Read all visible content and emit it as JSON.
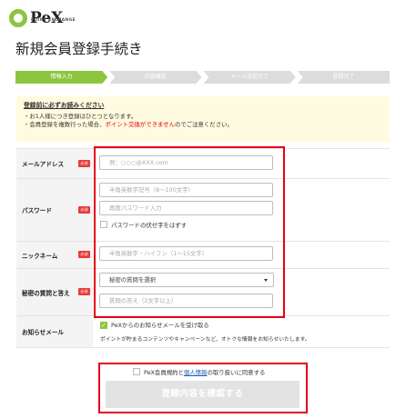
{
  "brand": {
    "name": "PeX",
    "tagline": "POINT EXCHANGE"
  },
  "page": {
    "title": "新規会員登録手続き"
  },
  "steps": [
    {
      "label": "情報入力",
      "active": true
    },
    {
      "label": "内容確認",
      "active": false
    },
    {
      "label": "メール送信完了",
      "active": false
    },
    {
      "label": "登録完了",
      "active": false
    }
  ],
  "notice": {
    "title": "登録前に必ずお読みください",
    "line1": "・お1人様につき登録はひとつとなります。",
    "line2_prefix": "・会員登録を複数行った場合、",
    "line2_warn": "ポイント交換ができません",
    "line2_suffix": "のでご注意ください。"
  },
  "form": {
    "required_badge": "必須",
    "email": {
      "label": "メールアドレス",
      "placeholder": "例：○○○@XXX.com"
    },
    "password": {
      "label": "パスワード",
      "placeholder": "半角英数字記号（8〜100文字）",
      "confirm_placeholder": "再度パスワード入力",
      "show_label": "パスワードの伏せ字をはずす"
    },
    "nickname": {
      "label": "ニックネーム",
      "placeholder": "半角英数字・ハイフン（1〜15文字）"
    },
    "secret": {
      "label": "秘密の質問と答え",
      "select_value": "秘密の質問を選択",
      "answer_placeholder": "質問の答え（2文字以上）"
    },
    "newsletter": {
      "label": "お知らせメール",
      "checkbox_label": "PeXからのお知らせメールを受け取る",
      "note": "ポイントが貯まるコンテンツやキャンペーンなど、オトクな情報をお知らせいたします。"
    }
  },
  "agreement": {
    "prefix": "PeX会員規約と",
    "link": "個人情報",
    "suffix": "の取り扱いに同意する"
  },
  "submit_label": "登録内容を確認する",
  "colors": {
    "accent": "#8cc63f",
    "warning": "#e60012",
    "link": "#1a5fb4"
  }
}
